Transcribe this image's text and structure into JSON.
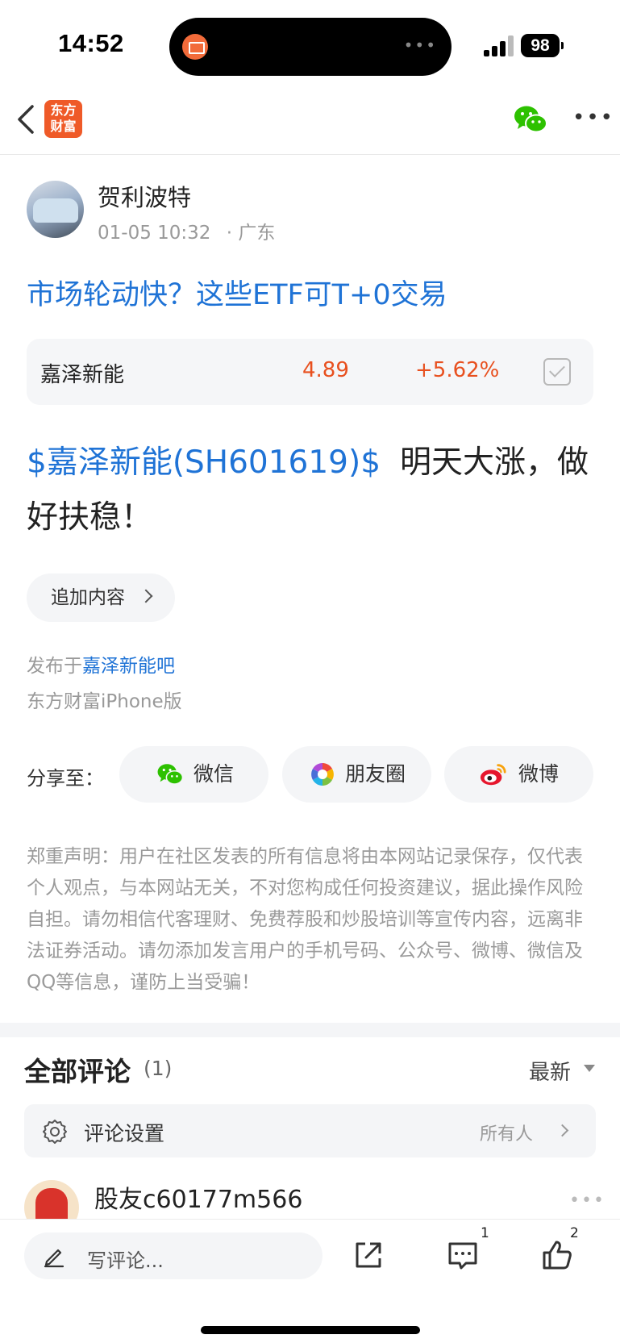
{
  "status_bar": {
    "time": "14:52",
    "battery": "98"
  },
  "nav": {
    "logo_text_line1": "东方",
    "logo_text_line2": "财富"
  },
  "post": {
    "author": "贺利波特",
    "datetime": "01-05 10:32",
    "location": "· 广东",
    "title": "市场轮动快？这些ETF可T+0交易",
    "stock": {
      "name": "嘉泽新能",
      "price": "4.89",
      "change": "+5.62%"
    },
    "body_link": "$嘉泽新能(SH601619)$",
    "body_text": "明天大涨，做好扶稳！",
    "append_label": "追加内容",
    "published_prefix": "发布于",
    "published_bar": "嘉泽新能吧",
    "client": "东方财富iPhone版"
  },
  "share": {
    "label": "分享至：",
    "buttons": [
      {
        "label": "微信",
        "icon": "wechat-icon"
      },
      {
        "label": "朋友圈",
        "icon": "moments-icon"
      },
      {
        "label": "微博",
        "icon": "weibo-icon"
      }
    ]
  },
  "disclaimer": "郑重声明：用户在社区发表的所有信息将由本网站记录保存，仅代表个人观点，与本网站无关，不对您构成任何投资建议，据此操作风险自担。请勿相信代客理财、免费荐股和炒股培训等宣传内容，远离非法证券活动。请勿添加发言用户的手机号码、公众号、微博、微信及QQ等信息，谨防上当受骗！",
  "comments": {
    "title": "全部评论",
    "count": "(1)",
    "sort": "最新",
    "settings_label": "评论设置",
    "settings_value": "所有人",
    "items": [
      {
        "name": "股友c60177m566"
      }
    ]
  },
  "bottom_bar": {
    "placeholder": "写评论...",
    "comment_count": "1",
    "like_count": "2"
  },
  "colors": {
    "accent_blue": "#1f73d6",
    "rise_red": "#e8501f",
    "brand_orange": "#ef5a28"
  }
}
